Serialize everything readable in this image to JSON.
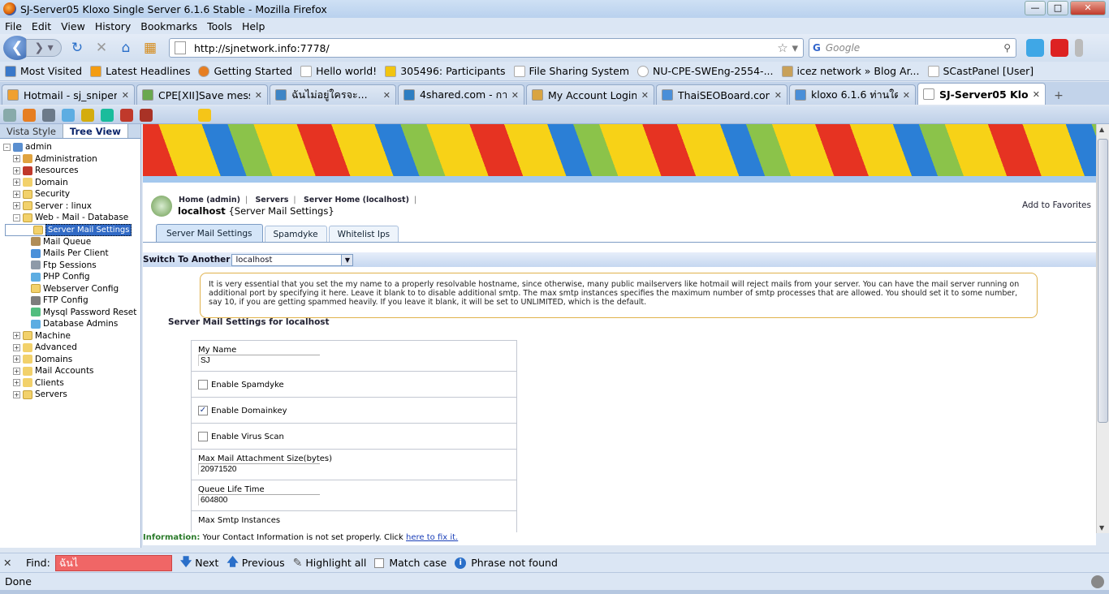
{
  "window": {
    "title": "SJ-Server05 Kloxo Single Server 6.1.6 Stable - Mozilla Firefox"
  },
  "menu": [
    "File",
    "Edit",
    "View",
    "History",
    "Bookmarks",
    "Tools",
    "Help"
  ],
  "nav": {
    "url": "http://sjnetwork.info:7778/",
    "search_placeholder": "Google"
  },
  "bookmarks": [
    "Most Visited",
    "Latest Headlines",
    "Getting Started",
    "Hello world!",
    "305496: Participants",
    "File Sharing System",
    "NU-CPE-SWEng-2554-...",
    "icez network » Blog Ar...",
    "SCastPanel [User]"
  ],
  "tabs": [
    {
      "label": "Hotmail - sj_sniper...",
      "color": "#f0a030",
      "width": 164
    },
    {
      "label": "CPE[XII]Save messa...",
      "color": "#6aa84f",
      "width": 162
    },
    {
      "label": "ฉันไม่อยู่ใครจะ...",
      "color": "#3d85c6",
      "width": 156
    },
    {
      "label": "4shared.com - การโ...",
      "color": "#2d7ec2",
      "width": 156
    },
    {
      "label": "My Account Login",
      "color": "#d9a441",
      "width": 158
    },
    {
      "label": "ThaiSEOBoard.com...",
      "color": "#4a8fd8",
      "width": 162
    },
    {
      "label": "kloxo 6.1.6 ท่านใดเ...",
      "color": "#4a8fd8",
      "width": 156
    },
    {
      "label": "SJ-Server05 Klox...",
      "color": "#ffffff",
      "width": 158,
      "active": true
    }
  ],
  "sidebar": {
    "tabs": [
      "Vista Style",
      "Tree View"
    ],
    "tree": [
      {
        "label": "admin",
        "level": 0
      },
      {
        "label": "Administration",
        "level": 1
      },
      {
        "label": "Resources",
        "level": 1
      },
      {
        "label": "Domain",
        "level": 1
      },
      {
        "label": "Security",
        "level": 1
      },
      {
        "label": "Server : linux",
        "level": 1
      },
      {
        "label": "Web - Mail - Database",
        "level": 1,
        "open": true
      },
      {
        "label": "Server Mail Settings",
        "level": 2,
        "selected": true
      },
      {
        "label": "Mail Queue",
        "level": 2
      },
      {
        "label": "Mails Per Client",
        "level": 2
      },
      {
        "label": "Ftp Sessions",
        "level": 2
      },
      {
        "label": "PHP Config",
        "level": 2
      },
      {
        "label": "Webserver Config",
        "level": 2
      },
      {
        "label": "FTP Config",
        "level": 2
      },
      {
        "label": "Mysql Password Reset",
        "level": 2
      },
      {
        "label": "Database Admins",
        "level": 2
      },
      {
        "label": "Machine",
        "level": 1
      },
      {
        "label": "Advanced",
        "level": 1
      },
      {
        "label": "Domains",
        "level": 1
      },
      {
        "label": "Mail Accounts",
        "level": 1
      },
      {
        "label": "Clients",
        "level": 1
      },
      {
        "label": "Servers",
        "level": 1
      }
    ]
  },
  "main": {
    "breadcrumb": [
      "Home (admin)",
      "Servers",
      "Server Home (localhost)"
    ],
    "host": "localhost",
    "page": "{Server Mail Settings}",
    "add_fav": "Add to Favorites",
    "tabs": [
      "Server Mail Settings",
      "Spamdyke",
      "Whitelist Ips"
    ],
    "switch_label": "Switch To Another",
    "switch_value": "localhost",
    "note": "It is very essential that you set the my name to a properly resolvable hostname, since otherwise, many public mailservers like hotmail will reject mails from your server. You can have the mail server running on additional port by specifying it here. Leave it blank to to disable additional smtp. The max smtp instances specifies the maximum number of smtp processes that are allowed. You should set it to some number, say 10, if you are getting spammed heavily. If you leave it blank, it will be set to UNLIMITED, which is the default.",
    "form_title": "Server Mail Settings for localhost",
    "fields": {
      "myname_label": "My Name",
      "myname_value": "SJ",
      "spamdyke": "Enable Spamdyke",
      "domainkey": "Enable Domainkey",
      "virus": "Enable Virus Scan",
      "attach_label": "Max Mail Attachment Size(bytes)",
      "attach_value": "20971520",
      "queue_label": "Queue Life Time",
      "queue_value": "604800",
      "smtp_label": "Max Smtp Instances"
    },
    "info_label": "Information:",
    "info_text": "Your Contact Information is not set properly. Click",
    "info_link": "here to fix it."
  },
  "find": {
    "label": "Find:",
    "value": "ฉันไ",
    "next": "Next",
    "previous": "Previous",
    "highlight": "Highlight all",
    "matchcase": "Match case",
    "status": "Phrase not found"
  },
  "status": "Done"
}
